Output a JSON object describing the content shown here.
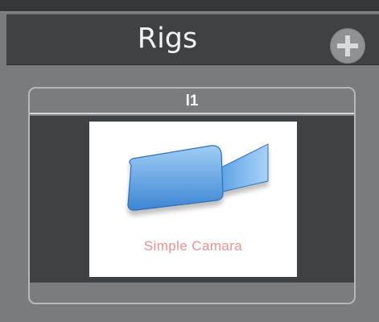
{
  "panel": {
    "title": "Rigs",
    "add_button_icon": "plus-icon"
  },
  "rigs": [
    {
      "name": "l1",
      "thumbnail_icon": "camera-icon",
      "thumbnail_label": "Simple Camara"
    }
  ],
  "colors": {
    "panel_bg": "#7a7b7d",
    "header_bg": "#3f4245",
    "card_body_bg": "#3f4244",
    "thumbnail_label": "#ee8e8e",
    "camera_fill": "#6faee8"
  }
}
